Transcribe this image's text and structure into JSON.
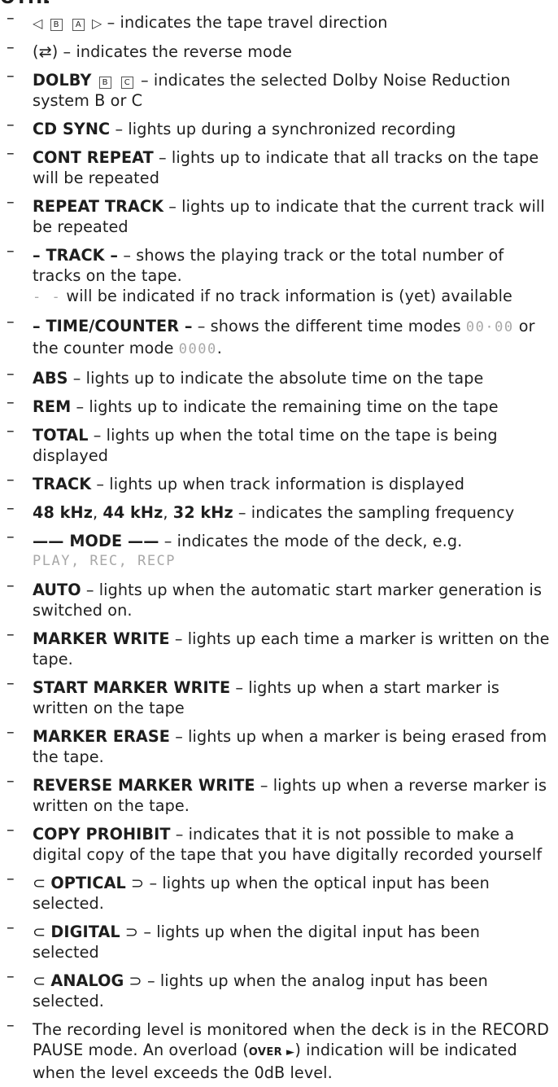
{
  "page": {
    "top_cut_text": "OTHERS"
  },
  "dash": "–",
  "items": [
    {
      "pre": "",
      "label": "",
      "text": " – indicates the tape travel direction"
    },
    {
      "pre": "",
      "label": "",
      "text": " – indicates the reverse mode"
    },
    {
      "label": "DOLBY",
      "text": " – indicates the selected Dolby Noise Reduction system B or C"
    },
    {
      "label": "CD SYNC",
      "text": " – lights up during a synchronized recording"
    },
    {
      "label": "CONT REPEAT",
      "text": " – lights up to indicate that all tracks on the tape will be repeated"
    },
    {
      "label": "REPEAT TRACK",
      "text": " – lights up to indicate that the current track will be repeated"
    },
    {
      "label": "– TRACK –",
      "text": " – shows the playing track or the total number of tracks on the tape.",
      "sub_lcd": "- -",
      "sub_text": " will be indicated if no track information is (yet) available"
    },
    {
      "label": "– TIME/COUNTER –",
      "text": " – shows the different time modes ",
      "lcd1": "00·00",
      "mid": " or the counter mode ",
      "lcd2": "0000",
      "end": "."
    },
    {
      "label": "ABS",
      "text": " – lights up to indicate the absolute time on the tape"
    },
    {
      "label": "REM",
      "text": " – lights up to indicate the remaining time on the tape"
    },
    {
      "label": "TOTAL",
      "text": " – lights up when the total time on the tape is being displayed"
    },
    {
      "label": "TRACK",
      "text": " – lights up when track information is displayed"
    },
    {
      "label1": "48 kHz",
      "sep1": ", ",
      "label2": "44 kHz",
      "sep2": ", ",
      "label3": "32 kHz",
      "text": " – indicates the sampling frequency"
    },
    {
      "label": "—— MODE ——",
      "text": " – indicates the mode of the deck, e.g.",
      "lcd": "PLAY, REC, RECP"
    },
    {
      "label": "AUTO",
      "text": " – lights up when the automatic start marker generation is switched on."
    },
    {
      "label": "MARKER WRITE",
      "text": " – lights up each time a marker is written on the tape."
    },
    {
      "label": "START MARKER WRITE",
      "text": " – lights up when a start marker is written on the tape"
    },
    {
      "label": "MARKER ERASE",
      "text": " – lights up when a marker is being erased from the tape."
    },
    {
      "label": "REVERSE MARKER WRITE",
      "text": " – lights up when a reverse marker is written on the tape."
    },
    {
      "label": "COPY PROHIBIT",
      "text": " – indicates that it is not possible to make a digital copy of the tape that you have digitally recorded yourself"
    },
    {
      "open": "⊂ ",
      "label": "OPTICAL",
      "close": " ⊃",
      "text": " – lights up when the optical input has been selected."
    },
    {
      "open": "⊂ ",
      "label": "DIGITAL",
      "close": " ⊃",
      "text": " – lights up when the digital input has been selected"
    },
    {
      "open": "⊂ ",
      "label": "ANALOG",
      "close": " ⊃",
      "text": " – lights up when the analog input has been selected."
    },
    {
      "text_a": "The recording level is monitored when the deck is in the RECORD PAUSE mode. An overload (",
      "over": "OVER ►",
      "text_b": ") indication will be indicated when the level exceeds the 0dB level."
    }
  ],
  "symbols": {
    "left_arrow": "◁",
    "right_arrow": "▷",
    "box_b": "B",
    "box_a": "A",
    "box_c": "C",
    "reverse_icon": "(⇄)"
  }
}
